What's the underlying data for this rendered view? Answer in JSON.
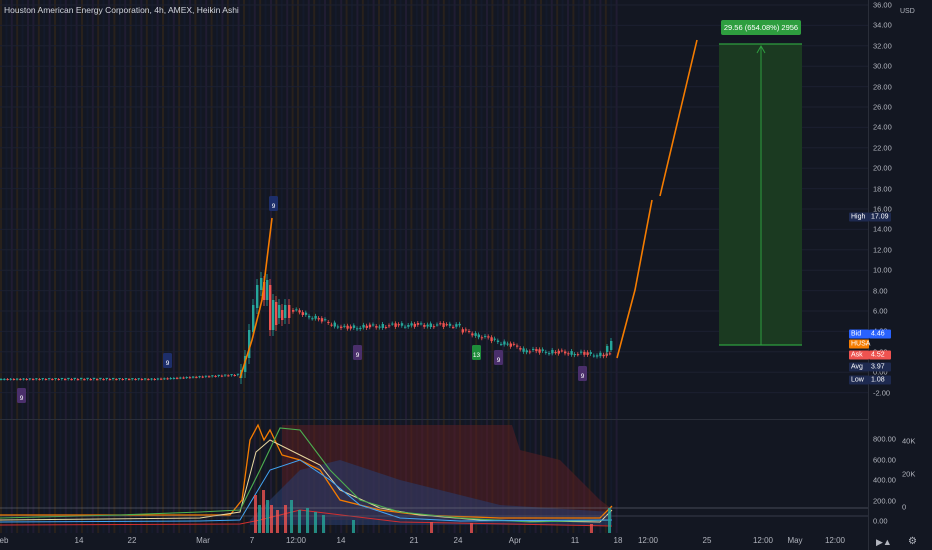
{
  "header": {
    "title": "Houston American Energy Corporation, 4h, AMEX, Heikin Ashi"
  },
  "price_axis": {
    "currency": "USD",
    "labels": [
      "36.00",
      "34.00",
      "32.00",
      "30.00",
      "28.00",
      "26.00",
      "24.00",
      "22.00",
      "20.00",
      "18.00",
      "16.00",
      "14.00",
      "12.00",
      "10.00",
      "8.00",
      "6.00",
      "4.00",
      "2.00",
      "0.00",
      "-2.00"
    ]
  },
  "price_tags": [
    {
      "name": "High",
      "value": "17.09",
      "bg": "#1e2a50"
    },
    {
      "name": "Bid",
      "value": "4.46",
      "bg": "#2962ff"
    },
    {
      "name": "HUSA",
      "value": "",
      "bg": "#f57c00"
    },
    {
      "name": "Ask",
      "value": "4.52",
      "bg": "#ef5350"
    },
    {
      "name": "Avg",
      "value": "3.97",
      "bg": "#1e2a50"
    },
    {
      "name": "Low",
      "value": "1.08",
      "bg": "#1e2a50"
    }
  ],
  "measure_label": "29.56 (654.08%) 2956",
  "indicator_axis": {
    "left_labels": [
      "800.00",
      "600.00",
      "400.00",
      "200.00",
      "0.00"
    ],
    "right_labels": [
      "40K",
      "20K",
      "0"
    ]
  },
  "time_axis": {
    "labels": [
      "eb",
      "14",
      "22",
      "Mar",
      "7",
      "12:00",
      "14",
      "21",
      "24",
      "Apr",
      "11",
      "18",
      "12:00",
      "25",
      "12:00",
      "May",
      "12:00"
    ]
  },
  "markers": [
    {
      "kind": "9-up",
      "label": "9"
    },
    {
      "kind": "9-down",
      "label": "9"
    },
    {
      "kind": "9-down-top",
      "label": "9"
    },
    {
      "kind": "9-up",
      "label": "9"
    },
    {
      "kind": "13-up",
      "label": "13"
    },
    {
      "kind": "9-up",
      "label": "9"
    },
    {
      "kind": "9-up",
      "label": "9"
    }
  ],
  "icons": {
    "logo": "tradingview-logo-icon",
    "settings": "gear-icon"
  },
  "colors": {
    "bg": "#131722",
    "bull": "#26a69a",
    "bear": "#ef5350",
    "projection": "#f57c00",
    "target": "#2e9e3f"
  }
}
